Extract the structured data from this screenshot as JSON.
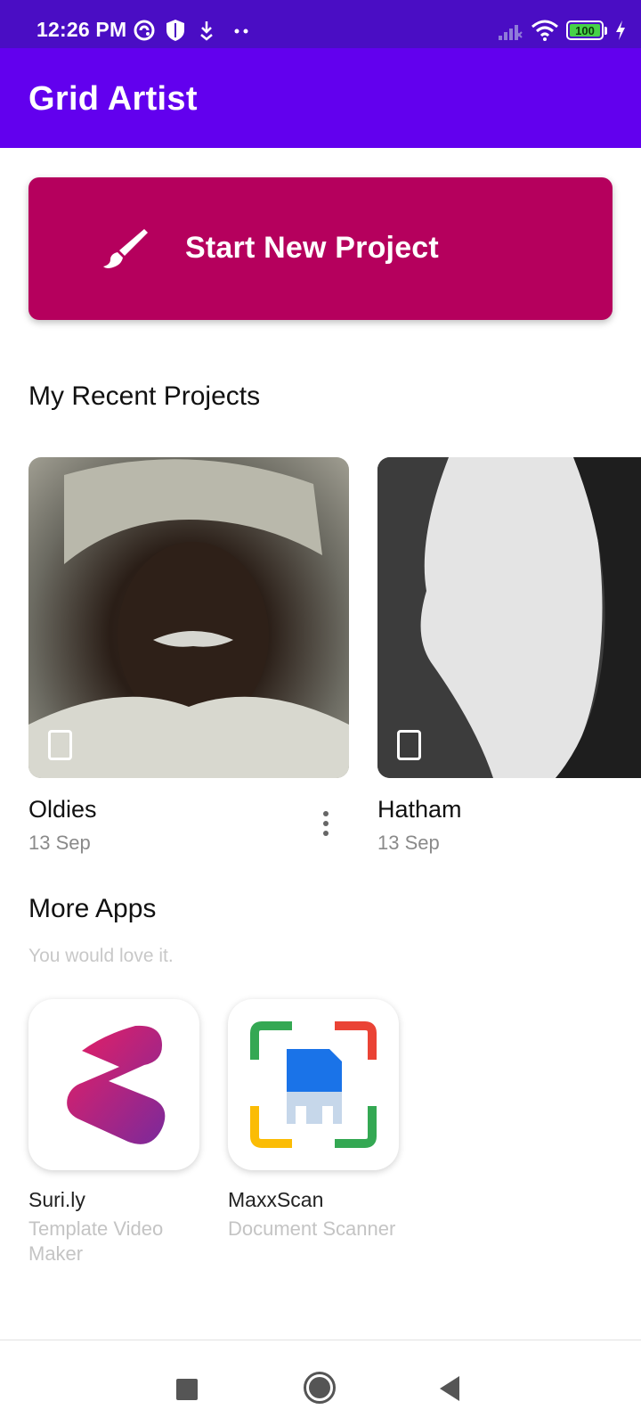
{
  "status_bar": {
    "time": "12:26 PM",
    "battery": "100",
    "icons": [
      "sync-icon",
      "shield-icon",
      "download-icon",
      "dots-icon",
      "signal-icon",
      "wifi-icon",
      "battery-icon",
      "charging-icon"
    ]
  },
  "app_bar": {
    "title": "Grid Artist"
  },
  "start_button": {
    "label": "Start New Project",
    "icon": "brush-icon"
  },
  "recent": {
    "title": "My Recent Projects",
    "projects": [
      {
        "name": "Oldies",
        "date": "13 Sep"
      },
      {
        "name": "Hatham",
        "date": "13 Sep"
      }
    ]
  },
  "more_apps": {
    "title": "More Apps",
    "subtitle": "You would love it.",
    "apps": [
      {
        "name": "Suri.ly",
        "desc": "Template Video Maker"
      },
      {
        "name": "MaxxScan",
        "desc": "Document Scanner"
      }
    ]
  },
  "colors": {
    "status_bar": "#4a0dc4",
    "app_bar": "#6200ee",
    "start_button": "#b5005d"
  }
}
